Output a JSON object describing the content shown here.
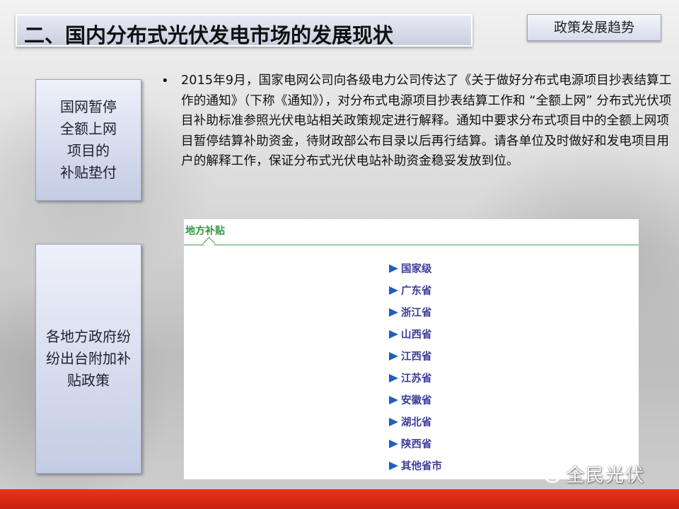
{
  "header": {
    "title": "二、国内分布式光伏发电市场的发展现状",
    "tag": "政策发展趋势"
  },
  "side_boxes": [
    {
      "text": "国网暂停\n全额上网\n项目的\n补贴垫付"
    },
    {
      "text": "各地方政府纷\n纷出台附加补\n贴政策"
    }
  ],
  "bullet": {
    "symbol": "•",
    "text": "2015年9月，国家电网公司向各级电力公司传达了《关于做好分布式电源项目抄表结算工作的通知》（下称《通知》），对分布式电源项目抄表结算工作和 “全额上网” 分布式光伏项目补助标准参照光伏电站相关政策规定进行解释。通知中要求分布式项目中的全额上网项目暂停结算补助资金，待财政部公布目录以后再行结算。请各单位及时做好和发电项目用户的解释工作，保证分布式光伏电站补助资金稳妥发放到位。"
  },
  "local_subsidy": {
    "title": "地方补贴",
    "items": [
      "国家级",
      "广东省",
      "浙江省",
      "山西省",
      "江西省",
      "江苏省",
      "安徽省",
      "湖北省",
      "陕西省",
      "其他省市"
    ]
  },
  "watermark": {
    "icon": "wechat-icon",
    "text": "全民光伏"
  },
  "colors": {
    "accent_green": "#3aa048",
    "list_blue": "#3d3d9a",
    "arrow_blue": "#1e5fbf",
    "footer_red": "#d9290f"
  }
}
